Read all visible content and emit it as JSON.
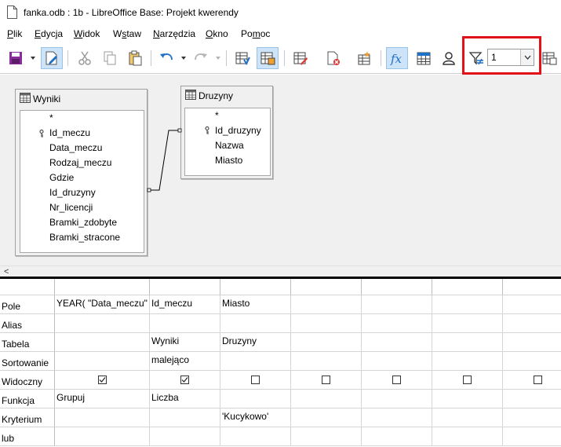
{
  "window": {
    "title": "fanka.odb : 1b - LibreOffice Base: Projekt kwerendy"
  },
  "menu": [
    {
      "label": "Plik",
      "underline": "P",
      "rest": "lik"
    },
    {
      "label": "Edycja",
      "underline": "E",
      "rest": "dycja"
    },
    {
      "label": "Widok",
      "underline": "W",
      "rest": "idok"
    },
    {
      "label": "Wstaw",
      "pre": "W",
      "underline": "s",
      "rest": "taw"
    },
    {
      "label": "Narzędzia",
      "underline": "N",
      "rest": "arzędzia"
    },
    {
      "label": "Okno",
      "underline": "O",
      "rest": "kno"
    },
    {
      "label": "Pomoc",
      "pre": "Po",
      "underline": "m",
      "rest": "oc"
    }
  ],
  "toolbar": {
    "limit_value": "1",
    "icons": [
      "save-icon",
      "edit-icon",
      "cut-icon",
      "copy-icon",
      "paste-icon",
      "undo-icon",
      "redo-icon",
      "run-query-icon",
      "clear-query-icon",
      "design-view-icon",
      "delete-icon",
      "add-table-icon",
      "functions-icon",
      "table-name-icon",
      "alias-icon",
      "distinct-values-icon",
      "limit-dropdown",
      "sql-view-icon"
    ]
  },
  "tables": [
    {
      "name": "Wyniki",
      "fields": [
        "*",
        "Id_meczu",
        "Data_meczu",
        "Rodzaj_meczu",
        "Gdzie",
        "Id_druzyny",
        "Nr_licencji",
        "Bramki_zdobyte",
        "Bramki_stracone"
      ],
      "key_field": "Id_meczu"
    },
    {
      "name": "Druzyny",
      "fields": [
        "*",
        "Id_druzyny",
        "Nazwa",
        "Miasto"
      ],
      "key_field": "Id_druzyny"
    }
  ],
  "grid": {
    "row_labels": [
      "Pole",
      "Alias",
      "Tabela",
      "Sortowanie",
      "Widoczny",
      "Funkcja",
      "Kryterium",
      "lub"
    ],
    "columns": [
      {
        "field": "YEAR( \"Data_meczu\" )",
        "alias": "",
        "table": "",
        "sort": "",
        "visible": true,
        "function": "Grupuj",
        "criterion": ""
      },
      {
        "field": "Id_meczu",
        "alias": "",
        "table": "Wyniki",
        "sort": "malejąco",
        "visible": true,
        "function": "Liczba",
        "criterion": ""
      },
      {
        "field": "Miasto",
        "alias": "",
        "table": "Druzyny",
        "sort": "",
        "visible": false,
        "function": "",
        "criterion": "'Kucykowo'"
      },
      {
        "field": "",
        "alias": "",
        "table": "",
        "sort": "",
        "visible": false,
        "function": "",
        "criterion": ""
      },
      {
        "field": "",
        "alias": "",
        "table": "",
        "sort": "",
        "visible": false,
        "function": "",
        "criterion": ""
      },
      {
        "field": "",
        "alias": "",
        "table": "",
        "sort": "",
        "visible": false,
        "function": "",
        "criterion": ""
      },
      {
        "field": "",
        "alias": "",
        "table": "",
        "sort": "",
        "visible": false,
        "function": "",
        "criterion": ""
      }
    ]
  },
  "colors": {
    "highlight": "#e3121a",
    "active_button": "#cde3f7",
    "icon_blue": "#1e6fc8"
  }
}
